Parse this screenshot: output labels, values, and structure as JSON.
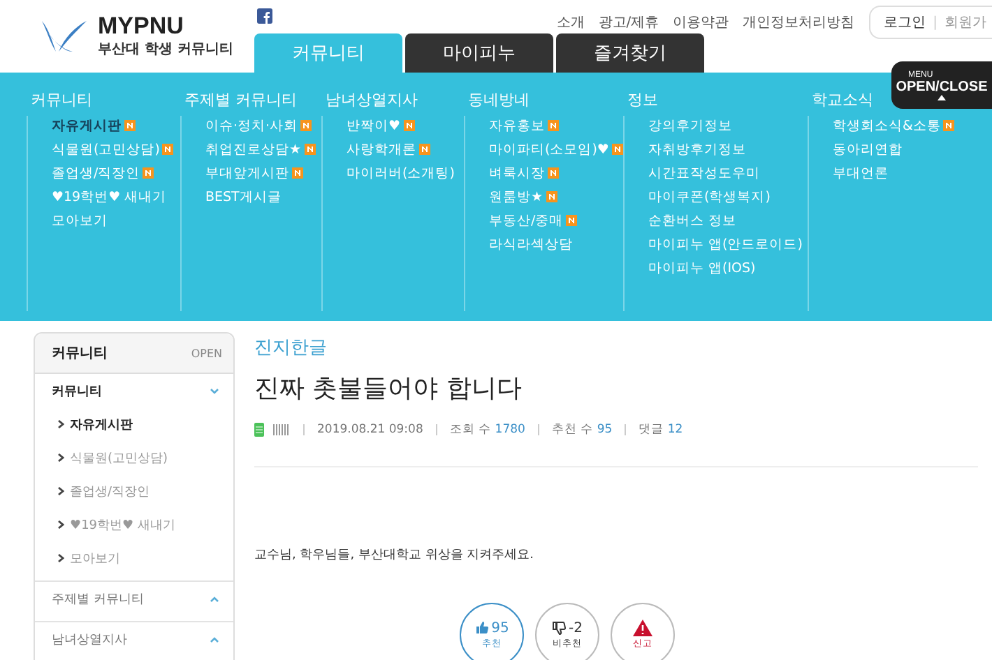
{
  "logo": {
    "name": "MYPNU",
    "subtitle": "부산대 학생 커뮤니티"
  },
  "top_links": [
    "소개",
    "광고/제휴",
    "이용약관",
    "개인정보처리방침"
  ],
  "account": {
    "login": "로그인",
    "separator": "|",
    "signup": "회원가"
  },
  "tabs": [
    {
      "label": "커뮤니티",
      "selected": true
    },
    {
      "label": "마이피누",
      "selected": false
    },
    {
      "label": "즐겨찾기",
      "selected": false
    }
  ],
  "menu_toggle": {
    "small": "MENU",
    "label": "OPEN/CLOSE"
  },
  "menu_columns": [
    {
      "title": "커뮤니티",
      "items": [
        {
          "label": "자유게시판",
          "new": true,
          "selected": true
        },
        {
          "label": "식물원(고민상담)",
          "new": true,
          "selected": false
        },
        {
          "label": "졸업생/직장인",
          "new": true,
          "selected": false
        },
        {
          "label": "♥19학번♥ 새내기",
          "new": false,
          "selected": false
        },
        {
          "label": "모아보기",
          "new": false,
          "selected": false
        }
      ]
    },
    {
      "title": "주제별 커뮤니티",
      "items": [
        {
          "label": "이슈·정치·사회",
          "new": true,
          "selected": false
        },
        {
          "label": "취업진로상담★",
          "new": true,
          "selected": false
        },
        {
          "label": "부대앞게시판",
          "new": true,
          "selected": false
        },
        {
          "label": "BEST게시글",
          "new": false,
          "selected": false
        }
      ]
    },
    {
      "title": "남녀상열지사",
      "items": [
        {
          "label": "반짝이♥",
          "new": true,
          "selected": false
        },
        {
          "label": "사랑학개론",
          "new": true,
          "selected": false
        },
        {
          "label": "마이러버(소개팅)",
          "new": false,
          "selected": false
        }
      ]
    },
    {
      "title": "동네방네",
      "items": [
        {
          "label": "자유홍보",
          "new": true,
          "selected": false
        },
        {
          "label": "마이파티(소모임)♥",
          "new": true,
          "selected": false
        },
        {
          "label": "벼룩시장",
          "new": true,
          "selected": false
        },
        {
          "label": "원룸방★",
          "new": true,
          "selected": false
        },
        {
          "label": "부동산/중매",
          "new": true,
          "selected": false
        },
        {
          "label": "라식라섹상담",
          "new": false,
          "selected": false
        }
      ]
    },
    {
      "title": "정보",
      "items": [
        {
          "label": "강의후기정보",
          "new": false,
          "selected": false
        },
        {
          "label": "자취방후기정보",
          "new": false,
          "selected": false
        },
        {
          "label": "시간표작성도우미",
          "new": false,
          "selected": false
        },
        {
          "label": "마이쿠폰(학생복지)",
          "new": false,
          "selected": false
        },
        {
          "label": "순환버스 정보",
          "new": false,
          "selected": false
        },
        {
          "label": "마이피누 앱(안드로이드)",
          "new": false,
          "selected": false
        },
        {
          "label": "마이피누 앱(IOS)",
          "new": false,
          "selected": false
        }
      ]
    },
    {
      "title": "학교소식",
      "items": [
        {
          "label": "학생회소식&소통",
          "new": true,
          "selected": false
        },
        {
          "label": "동아리연합",
          "new": false,
          "selected": false
        },
        {
          "label": "부대언론",
          "new": false,
          "selected": false
        }
      ]
    }
  ],
  "sidebar": {
    "title": "커뮤니티",
    "open_label": "OPEN",
    "sections": [
      {
        "title": "커뮤니티",
        "expanded": true,
        "items": [
          {
            "label": "자유게시판",
            "selected": true
          },
          {
            "label": "식물원(고민상담)",
            "selected": false
          },
          {
            "label": "졸업생/직장인",
            "selected": false
          },
          {
            "label": "♥19학번♥ 새내기",
            "selected": false
          },
          {
            "label": "모아보기",
            "selected": false
          }
        ]
      },
      {
        "title": "주제별 커뮤니티",
        "expanded": false
      },
      {
        "title": "남녀상열지사",
        "expanded": false
      }
    ]
  },
  "post": {
    "category": "진지한글",
    "title": "진짜 촛불들어야 합니다",
    "meta": [
      {
        "kind": "date",
        "label": "2019.08.21 09:08"
      },
      {
        "kind": "stat",
        "label": "조회 수",
        "value": "1780"
      },
      {
        "kind": "stat",
        "label": "추천 수",
        "value": "95"
      },
      {
        "kind": "stat",
        "label": "댓글",
        "value": "12"
      }
    ],
    "body": "교수님, 학우님들, 부산대학교 위상을 지켜주세요.",
    "actions": [
      {
        "kind": "up",
        "count": "95",
        "label": "추천"
      },
      {
        "kind": "down",
        "count": "-2",
        "label": "비추천"
      },
      {
        "kind": "report",
        "label": "신고"
      }
    ]
  }
}
